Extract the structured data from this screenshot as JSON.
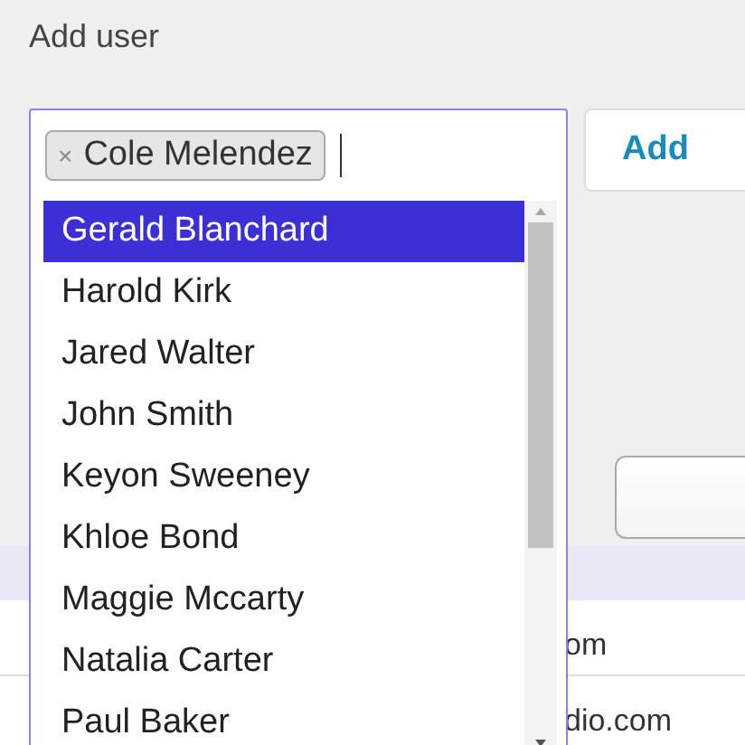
{
  "title": "Add user",
  "picker": {
    "chips": [
      {
        "label": "Cole Melendez",
        "remove": "×"
      }
    ],
    "options": [
      {
        "label": "Gerald Blanchard",
        "selected": true
      },
      {
        "label": "Harold Kirk",
        "selected": false
      },
      {
        "label": "Jared Walter",
        "selected": false
      },
      {
        "label": "John Smith",
        "selected": false
      },
      {
        "label": "Keyon Sweeney",
        "selected": false
      },
      {
        "label": "Khloe Bond",
        "selected": false
      },
      {
        "label": "Maggie Mccarty",
        "selected": false
      },
      {
        "label": "Natalia Carter",
        "selected": false
      },
      {
        "label": "Paul Baker",
        "selected": false
      }
    ]
  },
  "add_button": "Add",
  "table": {
    "rows": [
      {
        "column_1": "om"
      },
      {
        "column_1": "dio.com"
      }
    ]
  }
}
